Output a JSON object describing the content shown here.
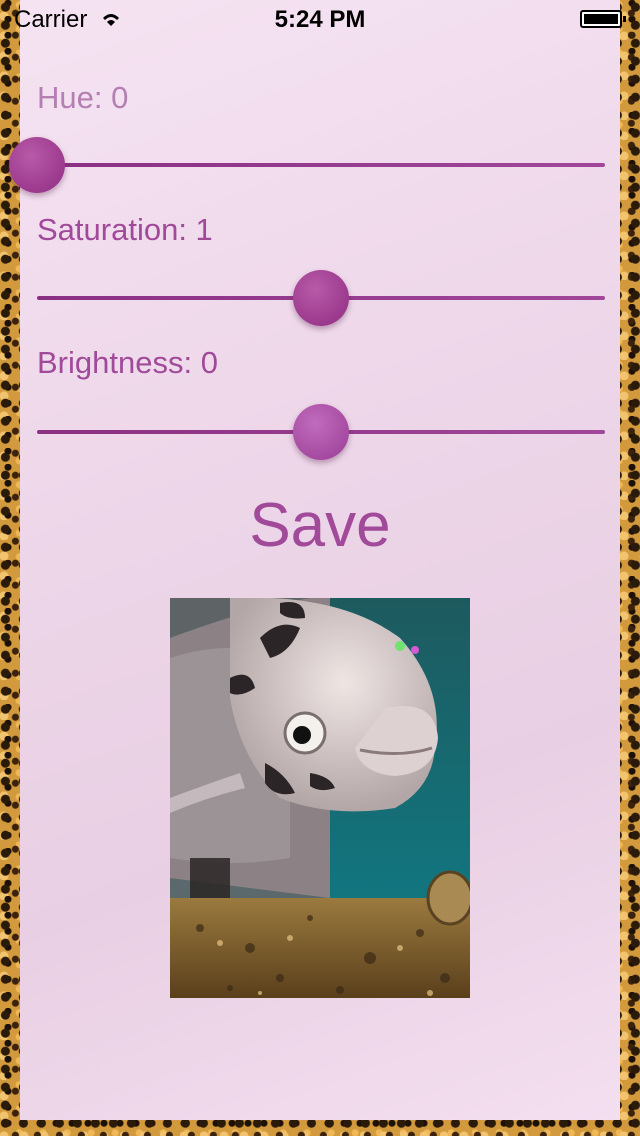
{
  "status_bar": {
    "carrier": "Carrier",
    "time": "5:24 PM",
    "wifi_icon": "wifi-icon",
    "battery_icon": "battery-icon"
  },
  "controls": {
    "hue": {
      "label": "Hue: 0",
      "value": 0,
      "min": 0,
      "max": 1
    },
    "saturation": {
      "label": "Saturation: 1",
      "value": 1,
      "min": 0,
      "max": 2
    },
    "brightness": {
      "label": "Brightness: 0",
      "value": 0,
      "min": -1,
      "max": 1
    }
  },
  "save_label": "Save",
  "photo": {
    "subject": "aquarium fish photo"
  },
  "colors": {
    "accent": "#a04a99",
    "track": "#8a2f82",
    "panel_bg": "#f0dcec",
    "border_pattern": "leopard"
  }
}
